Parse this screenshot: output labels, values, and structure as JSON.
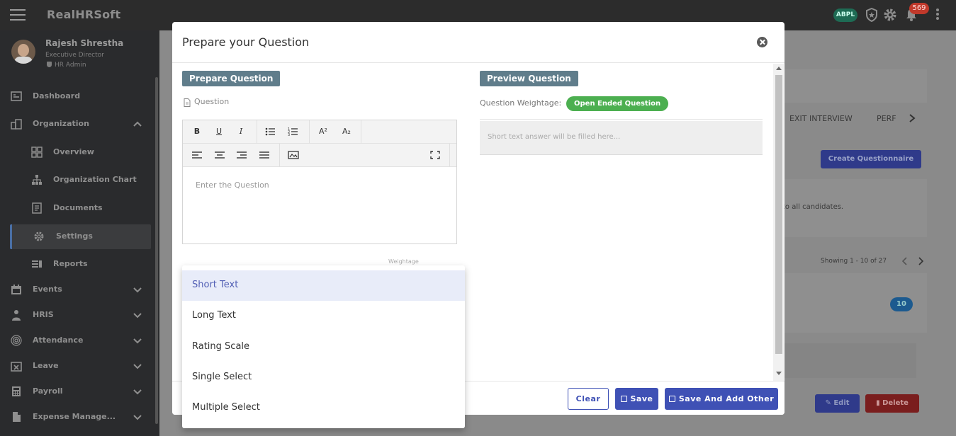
{
  "app": {
    "brand": "RealHRSoft",
    "company_badge": "ABPL",
    "notification_count": "569"
  },
  "profile": {
    "name": "Rajesh Shrestha",
    "role": "Executive Director",
    "admin": "HR Admin"
  },
  "sidebar": {
    "items": [
      {
        "label": "Dashboard",
        "icon": "dashboard-icon"
      },
      {
        "label": "Organization",
        "icon": "organization-icon",
        "expanded": true
      },
      {
        "label": "Overview",
        "icon": "overview-icon",
        "sub": true
      },
      {
        "label": "Organization Chart",
        "icon": "org-chart-icon",
        "sub": true
      },
      {
        "label": "Documents",
        "icon": "documents-icon",
        "sub": true
      },
      {
        "label": "Settings",
        "icon": "gear-icon",
        "sub": true,
        "active": true
      },
      {
        "label": "Reports",
        "icon": "reports-icon",
        "sub": true
      },
      {
        "label": "Events",
        "icon": "calendar-icon"
      },
      {
        "label": "HRIS",
        "icon": "person-icon"
      },
      {
        "label": "Attendance",
        "icon": "fingerprint-icon"
      },
      {
        "label": "Leave",
        "icon": "leave-icon"
      },
      {
        "label": "Payroll",
        "icon": "calculator-icon"
      },
      {
        "label": "Expense Manage...",
        "icon": "file-icon"
      }
    ]
  },
  "background": {
    "tab_exit_interview": "EXIT INTERVIEW",
    "tab_perf": "PERF",
    "create_questionnaire": "Create Questionnaire",
    "candidates_text": "to all candidates.",
    "showing": "Showing 1 - 10 of 27",
    "count_badge": "10",
    "edit": "Edit",
    "delete": "Delete"
  },
  "modal": {
    "title": "Prepare your Question",
    "prepare_section": "Prepare Question",
    "preview_section": "Preview Question",
    "question_label": "Question",
    "editor_placeholder": "Enter the Question",
    "weightage_label": "Weightage",
    "question_weightage_label": "Question Weightage:",
    "question_type_badge": "Open Ended Question",
    "preview_placeholder": "Short text answer will be filled here...",
    "buttons": {
      "clear": "Clear",
      "save": "Save",
      "save_add": "Save And Add Other"
    }
  },
  "toolbar": {
    "bold": "B",
    "underline": "U",
    "italic": "I",
    "superscript": "A²",
    "subscript": "A₂"
  },
  "question_types": {
    "options": [
      "Short Text",
      "Long Text",
      "Rating Scale",
      "Single Select",
      "Multiple Select"
    ],
    "selected": "Short Text"
  },
  "colors": {
    "primary": "#3f51b5",
    "section_chip": "#607d8b",
    "open_ended": "#4caf50",
    "notification": "#c0392b",
    "abpl_badge": "#1e6b54"
  }
}
